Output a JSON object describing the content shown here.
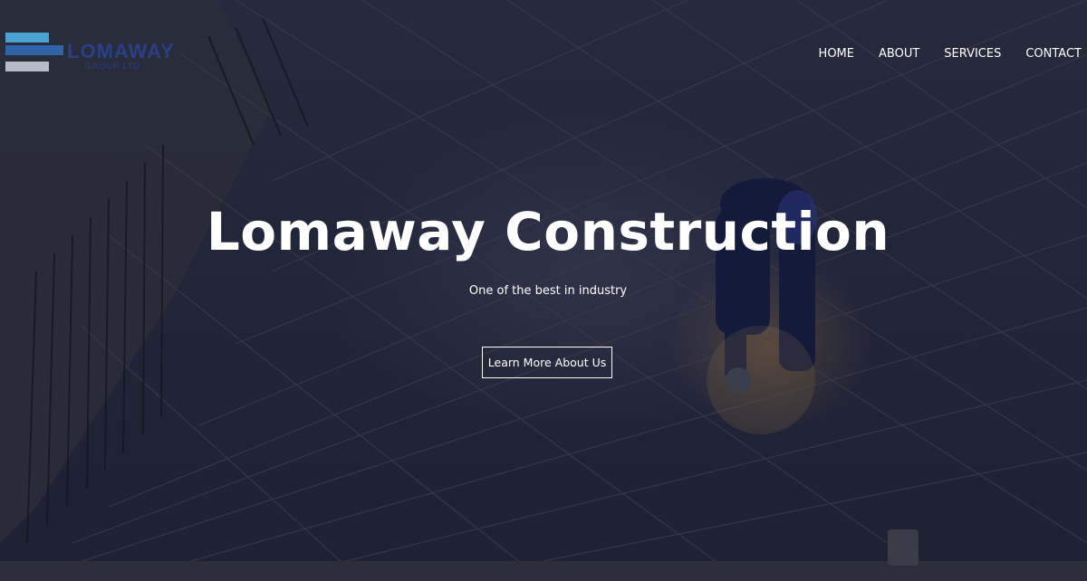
{
  "brand": {
    "name": "LOMAWAY",
    "tagline": "GROUP LTD",
    "colors": {
      "bar_top": "#4aa3d0",
      "bar_mid": "#2f64a6",
      "bar_bottom": "#b7bcc6",
      "text": "#2a3f86"
    }
  },
  "nav": {
    "items": [
      {
        "label": "HOME"
      },
      {
        "label": "ABOUT"
      },
      {
        "label": "SERVICES"
      },
      {
        "label": "CONTACT"
      }
    ]
  },
  "hero": {
    "title": "Lomaway Construction",
    "subtitle": "One of the best in industry",
    "cta_label": "Learn More About Us",
    "background_image": "construction-worker-rebar-icon"
  }
}
